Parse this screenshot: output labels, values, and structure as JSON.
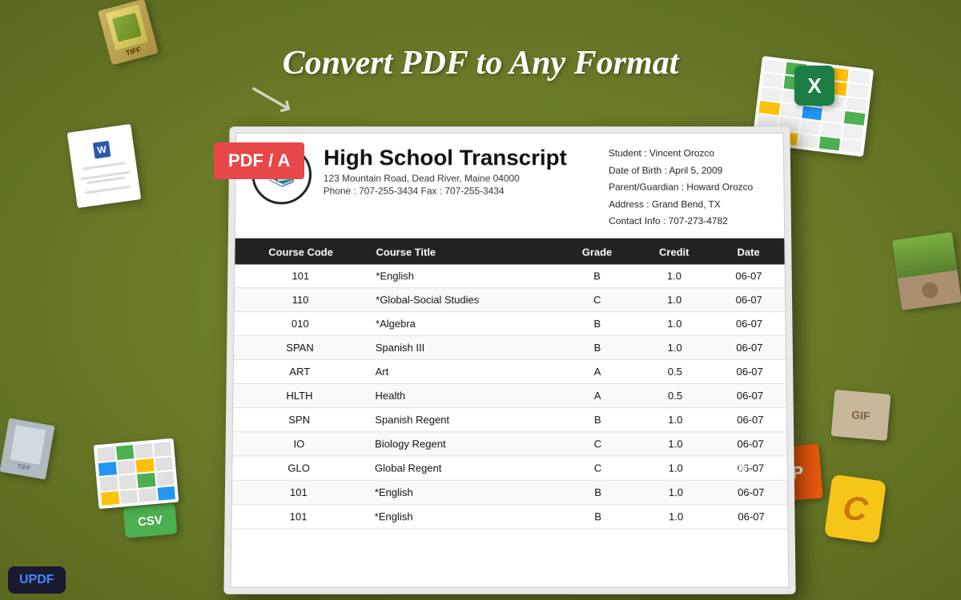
{
  "page": {
    "background_color": "#6b7a2a",
    "title": "Convert PDF to Any Format"
  },
  "header": {
    "title": "Convert PDF to Any Format"
  },
  "pdf_badge": {
    "label": "PDF / A"
  },
  "document": {
    "title": "High School Transcript",
    "address": "123 Mountain Road, Dead River, Maine 04000",
    "phone": "Phone : 707-255-3434    Fax : 707-255-3434",
    "student_label": "Student",
    "student_name": "Vincent Orozco",
    "dob_label": "Date of Birth",
    "dob_value": "April 5,  2009",
    "guardian_label": "Parent/Guardian",
    "guardian_name": "Howard Orozco",
    "address_label": "Address",
    "address_value": "Grand Bend, TX",
    "contact_label": "Contact Info",
    "contact_value": "707-273-4782",
    "table": {
      "columns": [
        "Course Code",
        "Course Title",
        "Grade",
        "Credit",
        "Date"
      ],
      "rows": [
        {
          "code": "101",
          "title": "*English",
          "grade": "B",
          "credit": "1.0",
          "date": "06-07"
        },
        {
          "code": "110",
          "title": "*Global-Social Studies",
          "grade": "C",
          "credit": "1.0",
          "date": "06-07"
        },
        {
          "code": "010",
          "title": "*Algebra",
          "grade": "B",
          "credit": "1.0",
          "date": "06-07"
        },
        {
          "code": "SPAN",
          "title": "Spanish III",
          "grade": "B",
          "credit": "1.0",
          "date": "06-07"
        },
        {
          "code": "ART",
          "title": "Art",
          "grade": "A",
          "credit": "0.5",
          "date": "06-07"
        },
        {
          "code": "HLTH",
          "title": "Health",
          "grade": "A",
          "credit": "0.5",
          "date": "06-07"
        },
        {
          "code": "SPN",
          "title": "Spanish Regent",
          "grade": "B",
          "credit": "1.0",
          "date": "06-07"
        },
        {
          "code": "IO",
          "title": "Biology Regent",
          "grade": "C",
          "credit": "1.0",
          "date": "06-07"
        },
        {
          "code": "GLO",
          "title": "Global Regent",
          "grade": "C",
          "credit": "1.0",
          "date": "06-07"
        },
        {
          "code": "101",
          "title": "*English",
          "grade": "B",
          "credit": "1.0",
          "date": "06-07"
        },
        {
          "code": "101",
          "title": "*English",
          "grade": "B",
          "credit": "1.0",
          "date": "06-07"
        }
      ]
    }
  },
  "updf": {
    "label": "UPDF"
  },
  "icons": {
    "tiff": "TIFF",
    "word": "W",
    "csv": "CSV",
    "excel": "X",
    "gif": "GIF",
    "ppt": "P",
    "c_lang": "C"
  }
}
